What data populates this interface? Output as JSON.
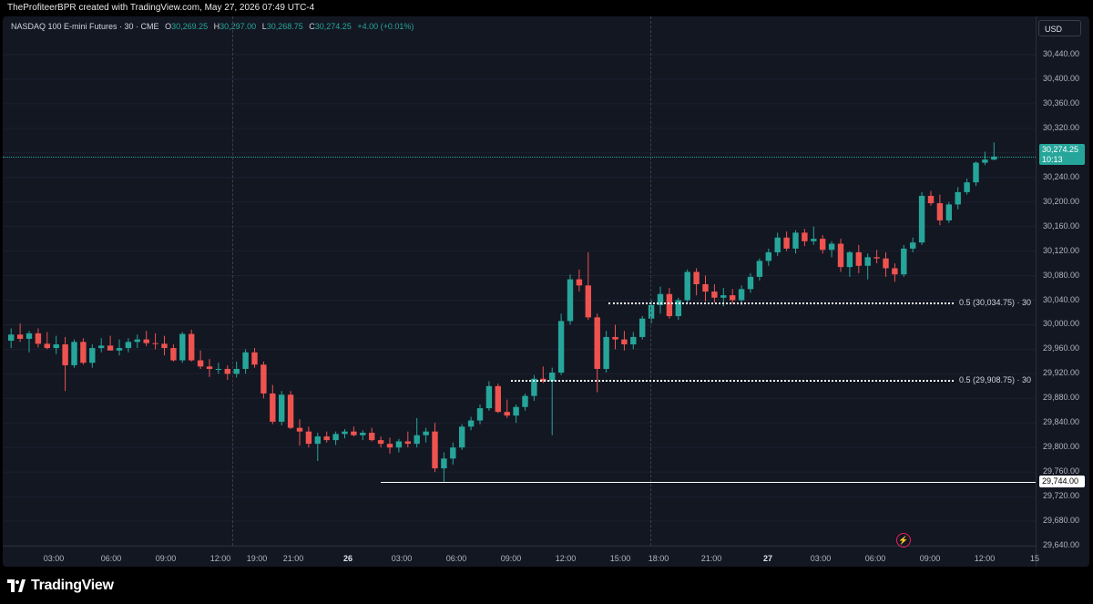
{
  "header": {
    "attribution": "TheProfiteerBPR created with TradingView.com, May 27, 2026 07:49 UTC-4"
  },
  "legend": {
    "symbol": "NASDAQ 100 E-mini Futures · 30 · CME",
    "open_label": "O",
    "open": "30,269.25",
    "high_label": "H",
    "high": "30,297.00",
    "low_label": "L",
    "low": "30,268.75",
    "close_label": "C",
    "close": "30,274.25",
    "change": "+4.00 (+0.01%)"
  },
  "currency_button": "USD",
  "price_axis": [
    "30,440.00",
    "30,400.00",
    "30,360.00",
    "30,320.00",
    "30,280.00",
    "30,240.00",
    "30,200.00",
    "30,160.00",
    "30,120.00",
    "30,080.00",
    "30,040.00",
    "30,000.00",
    "29,960.00",
    "29,920.00",
    "29,880.00",
    "29,840.00",
    "29,800.00",
    "29,760.00",
    "29,720.00",
    "29,680.00",
    "29,640.00"
  ],
  "time_axis": [
    {
      "label": "03:00",
      "bold": false
    },
    {
      "label": "06:00",
      "bold": false
    },
    {
      "label": "09:00",
      "bold": false
    },
    {
      "label": "12:00",
      "bold": false
    },
    {
      "label": "19:00",
      "bold": false
    },
    {
      "label": "21:00",
      "bold": false
    },
    {
      "label": "26",
      "bold": true
    },
    {
      "label": "03:00",
      "bold": false
    },
    {
      "label": "06:00",
      "bold": false
    },
    {
      "label": "09:00",
      "bold": false
    },
    {
      "label": "12:00",
      "bold": false
    },
    {
      "label": "15:00",
      "bold": false
    },
    {
      "label": "18:00",
      "bold": false
    },
    {
      "label": "21:00",
      "bold": false
    },
    {
      "label": "27",
      "bold": true
    },
    {
      "label": "03:00",
      "bold": false
    },
    {
      "label": "06:00",
      "bold": false
    },
    {
      "label": "09:00",
      "bold": false
    },
    {
      "label": "12:00",
      "bold": false
    },
    {
      "label": "15",
      "bold": false
    }
  ],
  "last_price_tag": {
    "price": "30,274.25",
    "countdown": "10:13"
  },
  "hidden_tick": "30,280.00",
  "horizontal_level_tag": "29,744.00",
  "fib_levels": [
    {
      "label": "0.5 (30,034.75) · 30",
      "price": 30034.75
    },
    {
      "label": "0.5 (29,908.75) · 30",
      "price": 29908.75
    }
  ],
  "horizontal_level": 29744,
  "footer": {
    "logo_text": "TradingView"
  },
  "colors": {
    "up": "#26a69a",
    "down": "#ef5350",
    "background": "#131722"
  },
  "chart_data": {
    "type": "candlestick",
    "ylim": [
      29640,
      30440
    ],
    "candles": [
      [
        29974,
        29994,
        29962,
        29984
      ],
      [
        29984,
        30002,
        29972,
        29977
      ],
      [
        29977,
        29990,
        29955,
        29986
      ],
      [
        29986,
        29994,
        29963,
        29969
      ],
      [
        29969,
        29988,
        29960,
        29962
      ],
      [
        29962,
        29982,
        29952,
        29968
      ],
      [
        29968,
        29980,
        29892,
        29934
      ],
      [
        29934,
        29976,
        29930,
        29972
      ],
      [
        29972,
        29978,
        29935,
        29938
      ],
      [
        29938,
        29968,
        29930,
        29962
      ],
      [
        29962,
        29978,
        29955,
        29966
      ],
      [
        29966,
        29982,
        29958,
        29958
      ],
      [
        29958,
        29976,
        29950,
        29962
      ],
      [
        29962,
        29978,
        29955,
        29972
      ],
      [
        29972,
        29984,
        29962,
        29976
      ],
      [
        29976,
        29990,
        29965,
        29970
      ],
      [
        29970,
        29986,
        29960,
        29969
      ],
      [
        29969,
        29982,
        29950,
        29962
      ],
      [
        29962,
        29968,
        29940,
        29942
      ],
      [
        29942,
        29988,
        29938,
        29985
      ],
      [
        29985,
        29992,
        29940,
        29942
      ],
      [
        29942,
        29958,
        29928,
        29932
      ],
      [
        29932,
        29944,
        29915,
        29928
      ],
      [
        29928,
        29938,
        29920,
        29928
      ],
      [
        29928,
        29934,
        29910,
        29920
      ],
      [
        29920,
        29940,
        29914,
        29928
      ],
      [
        29928,
        29960,
        29920,
        29955
      ],
      [
        29955,
        29962,
        29930,
        29935
      ],
      [
        29935,
        29940,
        29880,
        29888
      ],
      [
        29888,
        29902,
        29838,
        29842
      ],
      [
        29842,
        29892,
        29836,
        29886
      ],
      [
        29886,
        29892,
        29830,
        29832
      ],
      [
        29832,
        29846,
        29803,
        29826
      ],
      [
        29826,
        29834,
        29800,
        29806
      ],
      [
        29806,
        29824,
        29778,
        29818
      ],
      [
        29818,
        29826,
        29808,
        29812
      ],
      [
        29812,
        29826,
        29804,
        29822
      ],
      [
        29822,
        29830,
        29815,
        29826
      ],
      [
        29826,
        29834,
        29818,
        29820
      ],
      [
        29820,
        29828,
        29812,
        29824
      ],
      [
        29824,
        29832,
        29810,
        29812
      ],
      [
        29812,
        29818,
        29800,
        29806
      ],
      [
        29806,
        29816,
        29790,
        29800
      ],
      [
        29800,
        29814,
        29792,
        29810
      ],
      [
        29810,
        29826,
        29800,
        29806
      ],
      [
        29806,
        29848,
        29800,
        29820
      ],
      [
        29820,
        29832,
        29808,
        29826
      ],
      [
        29826,
        29840,
        29760,
        29766
      ],
      [
        29766,
        29792,
        29744,
        29782
      ],
      [
        29782,
        29808,
        29772,
        29800
      ],
      [
        29800,
        29838,
        29796,
        29834
      ],
      [
        29834,
        29850,
        29828,
        29844
      ],
      [
        29844,
        29870,
        29838,
        29864
      ],
      [
        29864,
        29908,
        29860,
        29900
      ],
      [
        29900,
        29904,
        29856,
        29858
      ],
      [
        29858,
        29878,
        29848,
        29852
      ],
      [
        29852,
        29870,
        29840,
        29866
      ],
      [
        29866,
        29888,
        29860,
        29884
      ],
      [
        29884,
        29918,
        29876,
        29912
      ],
      [
        29912,
        29932,
        29905,
        29908
      ],
      [
        29908,
        29930,
        29820,
        29922
      ],
      [
        29922,
        30018,
        29918,
        30006
      ],
      [
        30006,
        30082,
        30000,
        30074
      ],
      [
        30074,
        30090,
        30054,
        30064
      ],
      [
        30064,
        30118,
        30008,
        30012
      ],
      [
        30012,
        30018,
        29890,
        29928
      ],
      [
        29928,
        29990,
        29922,
        29980
      ],
      [
        29980,
        30000,
        29960,
        29976
      ],
      [
        29976,
        29990,
        29958,
        29968
      ],
      [
        29968,
        29988,
        29960,
        29980
      ],
      [
        29980,
        30014,
        29976,
        30010
      ],
      [
        30010,
        30040,
        30002,
        30032
      ],
      [
        30032,
        30062,
        30018,
        30050
      ],
      [
        30050,
        30060,
        30010,
        30014
      ],
      [
        30014,
        30044,
        30008,
        30040
      ],
      [
        30040,
        30090,
        30034,
        30086
      ],
      [
        30086,
        30092,
        30048,
        30066
      ],
      [
        30066,
        30080,
        30038,
        30054
      ],
      [
        30054,
        30066,
        30036,
        30044
      ],
      [
        30044,
        30060,
        30030,
        30048
      ],
      [
        30048,
        30058,
        30034,
        30040
      ],
      [
        30040,
        30064,
        30032,
        30058
      ],
      [
        30058,
        30084,
        30052,
        30078
      ],
      [
        30078,
        30108,
        30072,
        30104
      ],
      [
        30104,
        30124,
        30096,
        30118
      ],
      [
        30118,
        30150,
        30112,
        30142
      ],
      [
        30142,
        30152,
        30120,
        30124
      ],
      [
        30124,
        30154,
        30116,
        30150
      ],
      [
        30150,
        30156,
        30128,
        30136
      ],
      [
        30136,
        30160,
        30130,
        30140
      ],
      [
        30140,
        30146,
        30116,
        30122
      ],
      [
        30122,
        30136,
        30110,
        30132
      ],
      [
        30132,
        30140,
        30086,
        30094
      ],
      [
        30094,
        30120,
        30078,
        30118
      ],
      [
        30118,
        30130,
        30084,
        30096
      ],
      [
        30096,
        30116,
        30074,
        30110
      ],
      [
        30110,
        30122,
        30100,
        30108
      ],
      [
        30108,
        30118,
        30078,
        30092
      ],
      [
        30092,
        30100,
        30070,
        30082
      ],
      [
        30082,
        30130,
        30078,
        30124
      ],
      [
        30124,
        30142,
        30118,
        30134
      ],
      [
        30134,
        30216,
        30130,
        30210
      ],
      [
        30210,
        30218,
        30194,
        30198
      ],
      [
        30198,
        30212,
        30162,
        30170
      ],
      [
        30170,
        30200,
        30166,
        30196
      ],
      [
        30196,
        30224,
        30188,
        30216
      ],
      [
        30216,
        30238,
        30212,
        30232
      ],
      [
        30232,
        30266,
        30226,
        30264
      ],
      [
        30264,
        30282,
        30260,
        30269
      ],
      [
        30269,
        30297,
        30268,
        30274
      ]
    ]
  }
}
